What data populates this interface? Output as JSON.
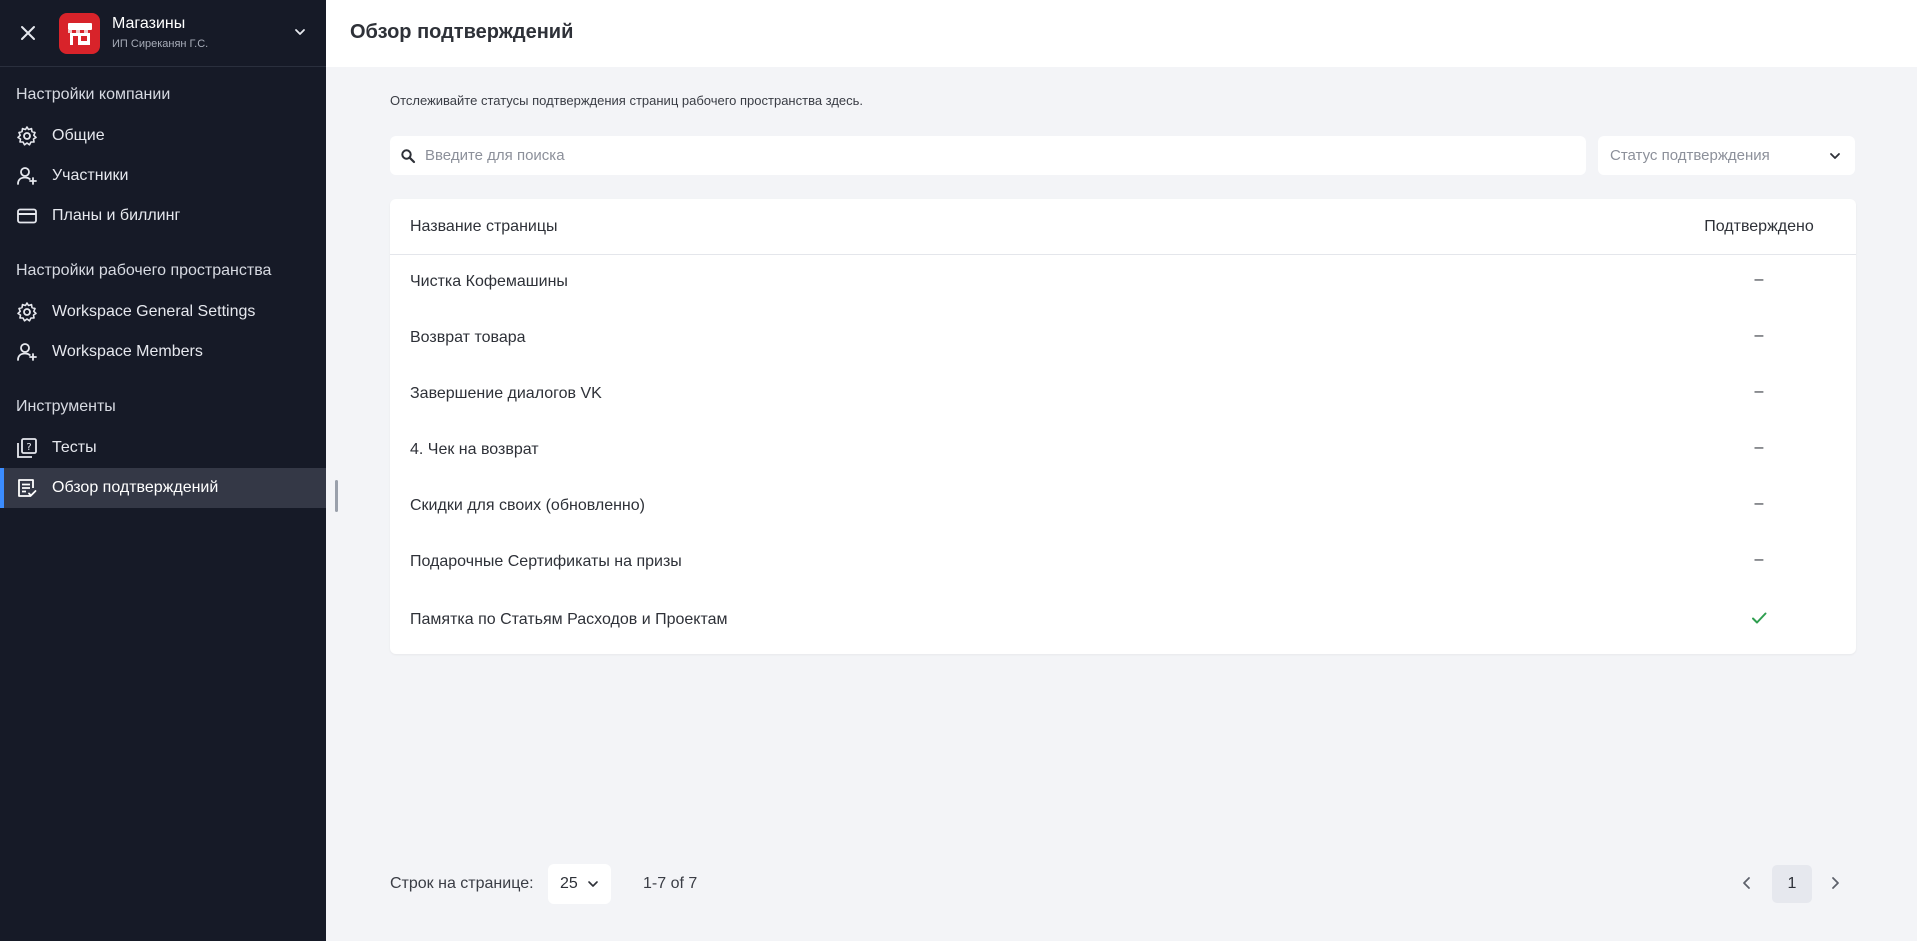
{
  "sidebar": {
    "org_name": "Магазины",
    "org_sub": "ИП Сиреканян Г.С.",
    "sections": {
      "company": "Настройки компании",
      "workspace": "Настройки рабочего пространства",
      "tools": "Инструменты"
    },
    "items": {
      "general": "Общие",
      "members": "Участники",
      "billing": "Планы и биллинг",
      "ws_general": "Workspace General Settings",
      "ws_members": "Workspace Members",
      "tests": "Тесты",
      "confirmations": "Обзор подтверждений"
    },
    "active_item": "confirmations",
    "colors": {
      "bg": "#161a27",
      "active_bg": "#343846",
      "active_accent": "#3b8cff",
      "logo": "#d8232a"
    }
  },
  "header": {
    "title": "Обзор подтверждений"
  },
  "main": {
    "subtitle": "Отслеживайте статусы подтверждения страниц рабочего пространства здесь.",
    "search": {
      "placeholder": "Введите для поиска",
      "value": ""
    },
    "status_filter": {
      "placeholder": "Статус подтверждения"
    }
  },
  "table": {
    "columns": {
      "name": "Название страницы",
      "confirmed": "Подтверждено"
    },
    "rows": [
      {
        "name": "Чистка Кофемашины",
        "confirmed": "–"
      },
      {
        "name": "Возврат товара",
        "confirmed": "–"
      },
      {
        "name": "Завершение диалогов VK",
        "confirmed": "–"
      },
      {
        "name": "4. Чек на возврат",
        "confirmed": "–"
      },
      {
        "name": "Скидки для своих (обновленно)",
        "confirmed": "–"
      },
      {
        "name": "Подарочные Сертификаты на призы",
        "confirmed": "–"
      },
      {
        "name": "Памятка по Статьям Расходов и Проектам",
        "confirmed": "check-icon"
      }
    ],
    "check_color": "#2e9e4f"
  },
  "pagination": {
    "rows_label": "Строк на странице:",
    "rows_value": "25",
    "range": "1-7 of 7",
    "current_page": "1"
  }
}
